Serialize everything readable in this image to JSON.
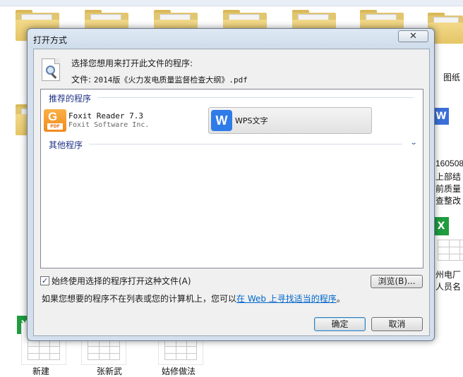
{
  "background": {
    "right_labels": [
      "图纸",
      "160508",
      "上部结",
      "前质量",
      "查整改",
      "州电厂",
      "人员名"
    ],
    "bottom_labels": [
      "新建",
      "张新武",
      "姑修做法"
    ],
    "icons": [
      "folder-icon",
      "wps-doc-icon",
      "excel-sheet-icon"
    ]
  },
  "dialog": {
    "title": "打开方式",
    "close_glyph": "✕",
    "prompt": "选择您想用来打开此文件的程序:",
    "file_prefix": "文件:",
    "file_name": "2014版《火力发电质量监督检查大纲》.pdf",
    "recommended_header": "推荐的程序",
    "other_header": "其他程序",
    "chevron": "⌄",
    "programs": [
      {
        "name": "Foxit Reader 7.3",
        "publisher": "Foxit Software Inc.",
        "icon": "foxit-reader-icon",
        "logo_text": "G",
        "badge": "PDF"
      },
      {
        "name": "WPS文字",
        "icon": "wps-writer-icon",
        "logo_text": "W"
      }
    ],
    "always_use_label": "始终使用选择的程序打开这种文件(A)",
    "always_use_checked": true,
    "browse_label": "浏览(B)...",
    "hint_text": "如果您想要的程序不在列表或您的计算机上，您可以",
    "hint_link": "在 Web 上寻找适当的程序",
    "hint_end": "。",
    "ok_label": "确定",
    "cancel_label": "取消"
  },
  "colors": {
    "dialog_frame": "#d3dfec",
    "link": "#0066cc",
    "group_header": "#1e3287",
    "foxit_orange": "#f08a1c",
    "wps_blue": "#2f7be8"
  }
}
